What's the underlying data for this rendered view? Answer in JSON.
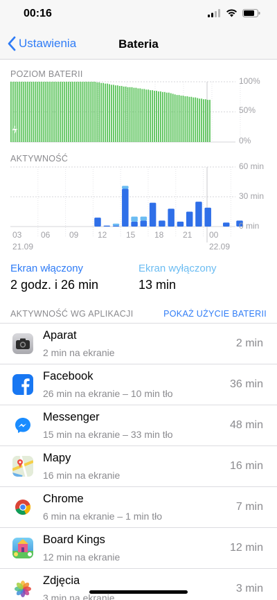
{
  "status_bar": {
    "time": "00:16"
  },
  "nav": {
    "back_label": "Ustawienia",
    "title": "Bateria"
  },
  "battery_level": {
    "section_label": "POZIOM BATERII",
    "y_ticks": [
      "100%",
      "50%",
      "0%"
    ]
  },
  "activity": {
    "section_label": "AKTYWNOŚĆ",
    "y_ticks": [
      "60 min",
      "30 min",
      "0 min"
    ],
    "x_ticks": [
      "03",
      "06",
      "09",
      "12",
      "15",
      "18",
      "21",
      "00"
    ],
    "date_left": "21.09",
    "date_right": "22.09"
  },
  "summary": {
    "screen_on_label": "Ekran włączony",
    "screen_on_value": "2 godz. i 26 min",
    "screen_off_label": "Ekran wyłączony",
    "screen_off_value": "13 min"
  },
  "apps": {
    "header": "AKTYWNOŚĆ WG APLIKACJI",
    "link": "POKAŻ UŻYCIE BATERII",
    "items": [
      {
        "name": "Aparat",
        "sub": "2 min na ekranie",
        "time": "2 min",
        "icon": "camera-icon"
      },
      {
        "name": "Facebook",
        "sub": "26 min na ekranie – 10 min tło",
        "time": "36 min",
        "icon": "facebook-icon"
      },
      {
        "name": "Messenger",
        "sub": "15 min na ekranie – 33 min tło",
        "time": "48 min",
        "icon": "messenger-icon"
      },
      {
        "name": "Mapy",
        "sub": "16 min na ekranie",
        "time": "16 min",
        "icon": "maps-icon"
      },
      {
        "name": "Chrome",
        "sub": "6 min na ekranie – 1 min tło",
        "time": "7 min",
        "icon": "chrome-icon"
      },
      {
        "name": "Board Kings",
        "sub": "12 min na ekranie",
        "time": "12 min",
        "icon": "board-kings-icon"
      },
      {
        "name": "Zdjęcia",
        "sub": "3 min na ekranie",
        "time": "3 min",
        "icon": "photos-icon"
      }
    ]
  },
  "chart_data": [
    {
      "type": "bar",
      "title": "POZIOM BATERII",
      "ylabel": "",
      "ylim": [
        0,
        100
      ],
      "yticks": [
        "0%",
        "50%",
        "100%"
      ],
      "color": "#5ac35a",
      "charging_until_index": 1,
      "values": [
        100,
        100,
        100,
        100,
        100,
        100,
        100,
        100,
        100,
        100,
        100,
        100,
        100,
        100,
        100,
        100,
        100,
        100,
        100,
        100,
        100,
        100,
        100,
        100,
        100,
        100,
        100,
        100,
        100,
        100,
        100,
        100,
        100,
        100,
        100,
        100,
        100,
        100,
        100,
        100,
        100,
        100,
        99,
        99,
        98,
        98,
        97,
        97,
        96,
        95,
        95,
        94,
        94,
        93,
        93,
        92,
        92,
        91,
        91,
        91,
        90,
        90,
        89,
        89,
        88,
        88,
        87,
        87,
        86,
        86,
        85,
        85,
        84,
        84,
        83,
        83,
        82,
        82,
        81,
        80,
        79,
        78,
        78,
        77,
        77,
        76,
        76,
        75,
        75,
        74,
        74,
        73,
        72,
        72,
        71,
        71,
        70,
        70
      ]
    },
    {
      "type": "bar",
      "title": "AKTYWNOŚĆ",
      "ylabel": "",
      "ylim": [
        0,
        60
      ],
      "yticks": [
        "0 min",
        "30 min",
        "60 min"
      ],
      "categories": [
        "00",
        "01",
        "02",
        "03",
        "04",
        "05",
        "06",
        "07",
        "08",
        "09",
        "10",
        "11",
        "12",
        "13",
        "14",
        "15",
        "16",
        "17",
        "18",
        "19",
        "20",
        "21",
        "22",
        "23",
        "00"
      ],
      "series": [
        {
          "color": "#2f6fe8",
          "values": [
            0,
            0,
            0,
            0,
            0,
            0,
            0,
            0,
            0,
            9,
            1,
            1,
            38,
            5,
            6,
            24,
            6,
            18,
            5,
            15,
            25,
            19,
            0,
            4,
            6
          ]
        },
        {
          "color": "#6bbcf2",
          "values": [
            0,
            0,
            0,
            0,
            0,
            0,
            0,
            0,
            0,
            0,
            0,
            2,
            3,
            5,
            4,
            0,
            0,
            0,
            0,
            0,
            0,
            0,
            0,
            0,
            0
          ]
        }
      ]
    }
  ]
}
